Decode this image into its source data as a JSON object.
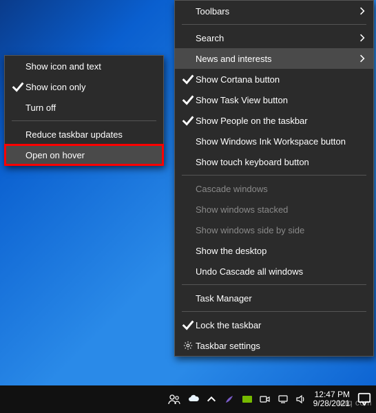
{
  "submenu": {
    "items": [
      {
        "label": "Show icon and text",
        "checked": false
      },
      {
        "label": "Show icon only",
        "checked": true
      },
      {
        "label": "Turn off",
        "checked": false
      }
    ],
    "reduce_label": "Reduce taskbar updates",
    "open_hover_label": "Open on hover"
  },
  "mainmenu": {
    "toolbars": "Toolbars",
    "search": "Search",
    "news": "News and interests",
    "cortana": "Show Cortana button",
    "taskview": "Show Task View button",
    "people": "Show People on the taskbar",
    "ink": "Show Windows Ink Workspace button",
    "touchkb": "Show touch keyboard button",
    "cascade": "Cascade windows",
    "stacked": "Show windows stacked",
    "sidebyside": "Show windows side by side",
    "showdesktop": "Show the desktop",
    "undo": "Undo Cascade all windows",
    "taskmgr": "Task Manager",
    "lock": "Lock the taskbar",
    "settings": "Taskbar settings"
  },
  "clock": {
    "time": "12:47 PM",
    "date": "9/28/2021"
  },
  "watermark": "uaq com"
}
